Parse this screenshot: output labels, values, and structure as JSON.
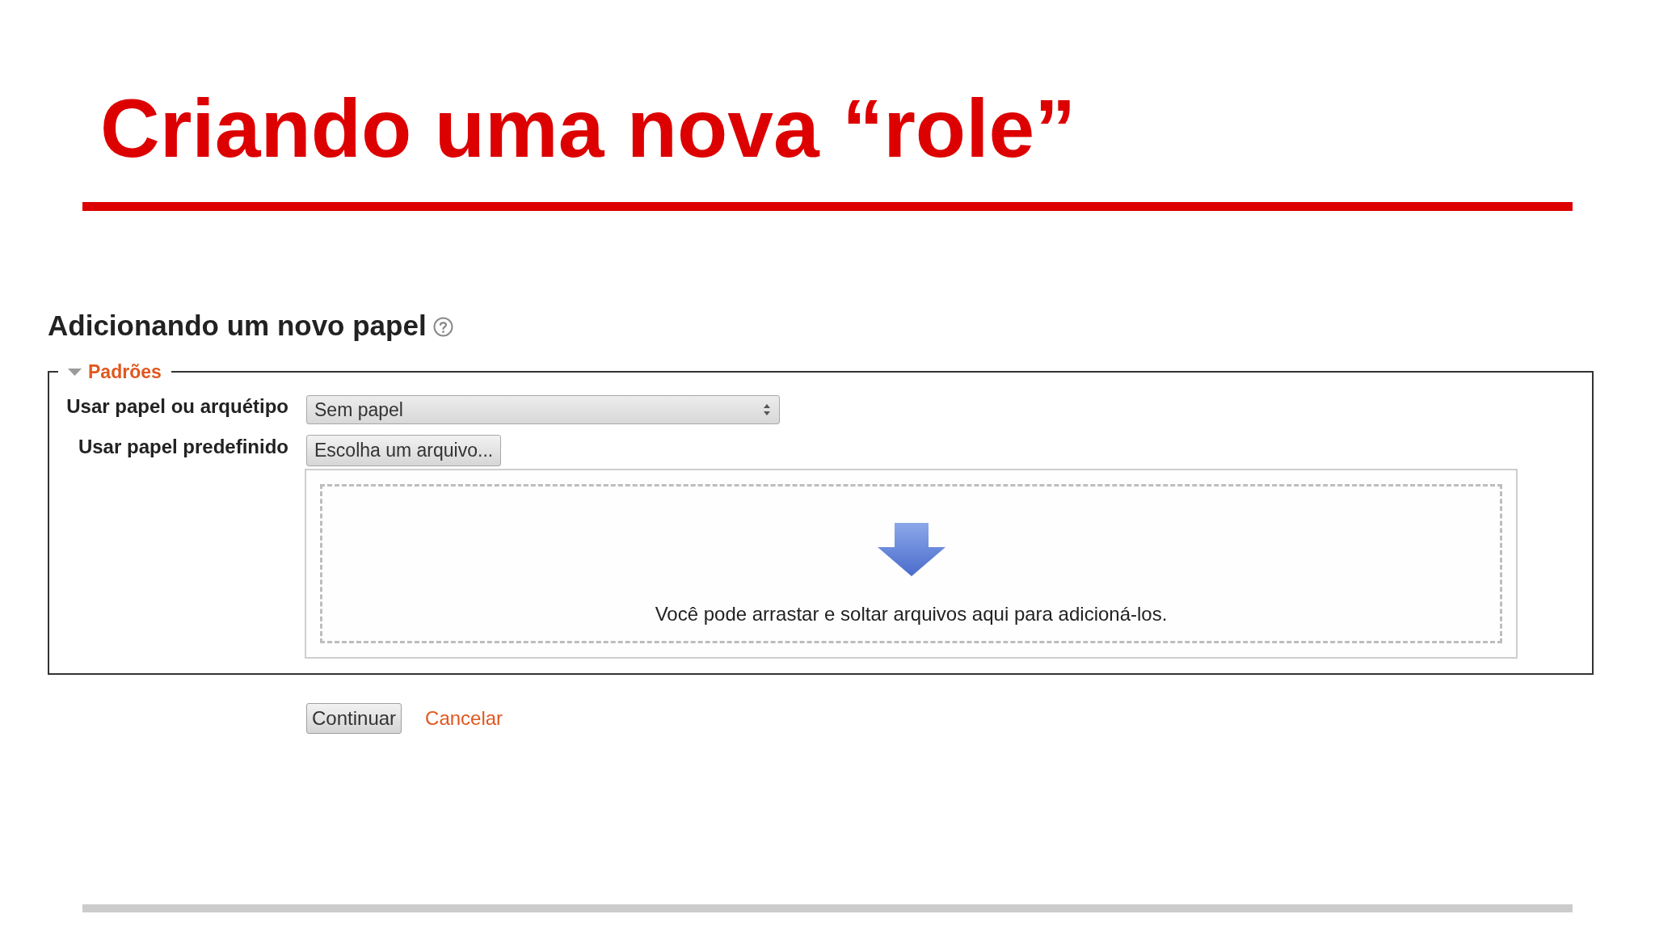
{
  "slide": {
    "title": "Criando uma nova “role”"
  },
  "page": {
    "heading": "Adicionando um novo papel",
    "fieldset": {
      "legend": "Padrões",
      "expanded": true,
      "fields": [
        {
          "kind": "select",
          "label": "Usar papel ou arquétipo",
          "value": "Sem papel"
        },
        {
          "kind": "filepicker",
          "label": "Usar papel predefinido",
          "button": "Escolha um arquivo...",
          "dropzone_text": "Você pode arrastar e soltar arquivos aqui para adicioná-los."
        }
      ]
    },
    "actions": [
      {
        "kind": "button",
        "label": "Continuar"
      },
      {
        "kind": "link",
        "label": "Cancelar"
      }
    ]
  }
}
